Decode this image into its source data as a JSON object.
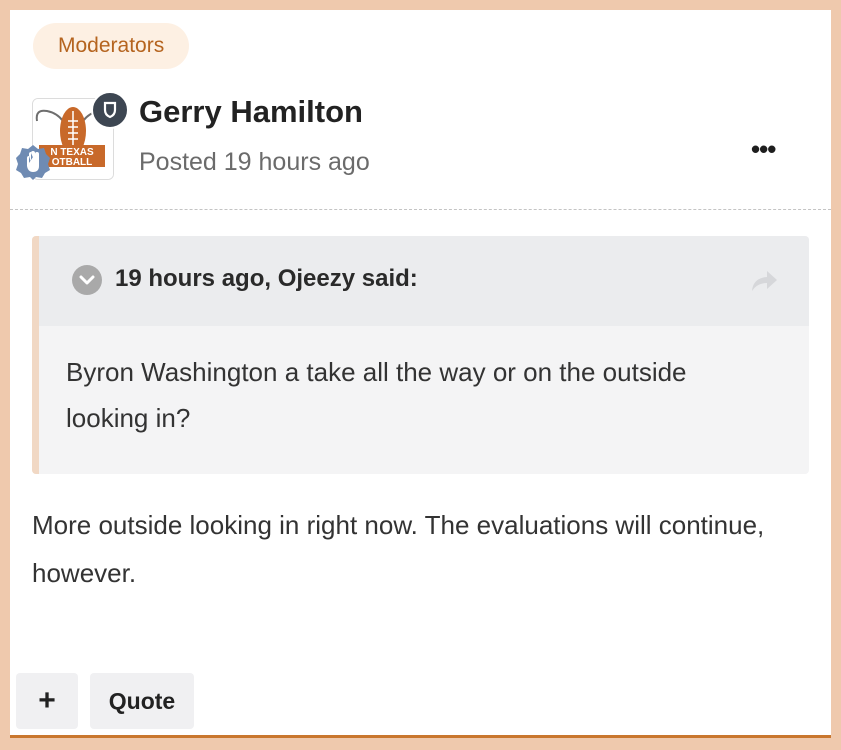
{
  "badge": {
    "label": "Moderators"
  },
  "post": {
    "author": "Gerry Hamilton",
    "posted": "Posted 19 hours ago",
    "avatar_text_line1": "N TEXAS",
    "avatar_text_line2": "OTBALL",
    "more_label": "•••",
    "body": "More outside looking in right now. The evaluations will continue, however."
  },
  "quote": {
    "citation": "19 hours ago, Ojeezy said:",
    "body": "Byron Washington a take all the way or on the outside looking in?"
  },
  "actions": {
    "plus_label": "+",
    "quote_label": "Quote"
  },
  "icons": {
    "moderator": "shield-icon",
    "rank": "hand-badge-icon",
    "toggle": "chevron-down-icon",
    "share": "share-arrow-icon",
    "more": "ellipsis-icon"
  },
  "colors": {
    "page_bg": "#efc9ad",
    "accent": "#b5641f",
    "badge_bg": "#fdf0e3",
    "bottom_rule": "#c9772e",
    "quote_bar": "#f1d8c4"
  }
}
